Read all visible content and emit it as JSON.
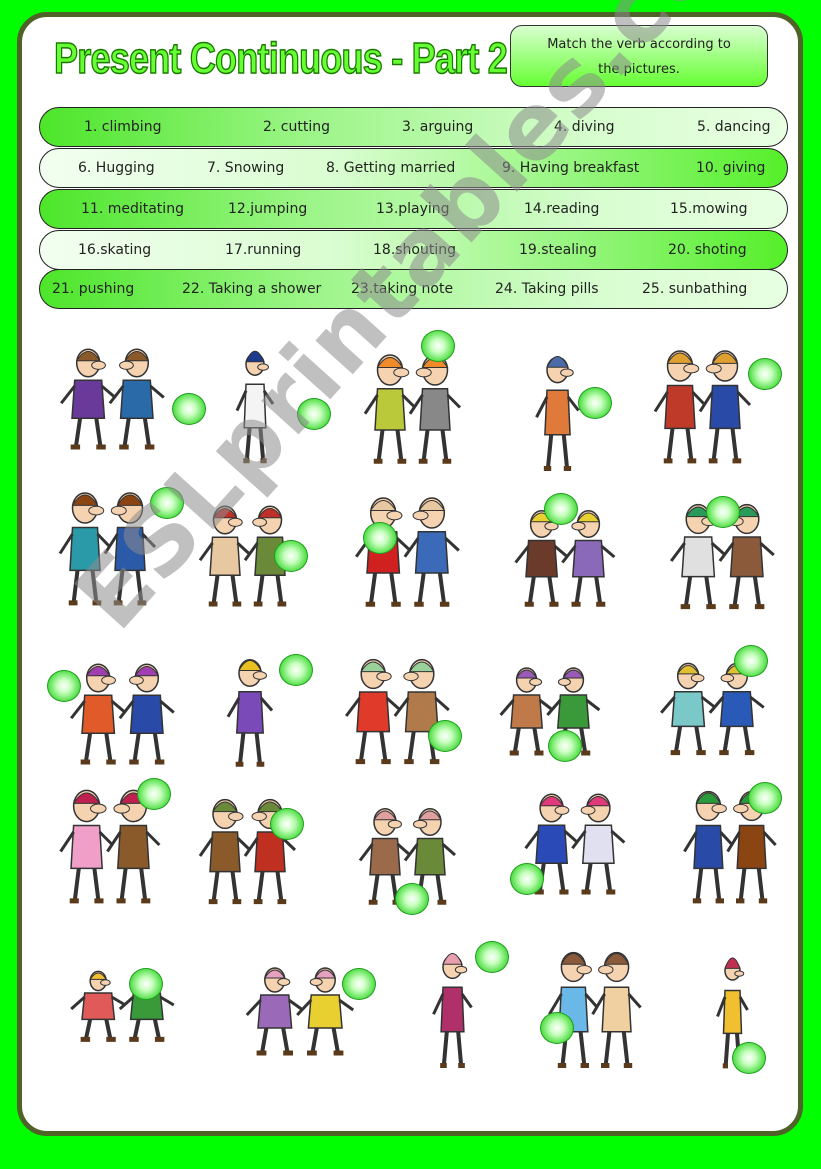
{
  "page": {
    "title": "Present Continuous - Part 2",
    "instructions": "Match the verb according to the pictures.",
    "instructions_line1": "Match the verb according to",
    "instructions_line2": "the pictures.",
    "watermark": "ESLprintables.com",
    "colors": {
      "background": "#00ff00",
      "frame": "#4f6228",
      "title_fill": "#66ff33",
      "row_green": "#4de52a",
      "row_pale": "#e8ffe2",
      "answer_dot": "#55e04a"
    }
  },
  "word_bank": [
    {
      "style": "a",
      "words": [
        "1.   climbing",
        "2. cutting",
        "3. arguing",
        "4. diving",
        "5. dancing"
      ]
    },
    {
      "style": "b",
      "words": [
        "6.  Hugging",
        "7. Snowing",
        "8. Getting married",
        "9. Having breakfast",
        "10. giving"
      ]
    },
    {
      "style": "a",
      "words": [
        "11. meditating",
        "12.jumping",
        "13.playing",
        "14.reading",
        "15.mowing"
      ]
    },
    {
      "style": "b",
      "words": [
        "16.skating",
        "17.running",
        "18.shouting",
        "19.stealing",
        "20. shoting"
      ]
    },
    {
      "style": "a",
      "words": [
        "21. pushing",
        "22. Taking a shower",
        "23.taking note",
        "24. Taking pills",
        "25. sunbathing"
      ]
    }
  ],
  "pictures": [
    {
      "scene": "snowing",
      "answer": ""
    },
    {
      "scene": "getting-married",
      "answer": ""
    },
    {
      "scene": "giving-flowers",
      "answer": ""
    },
    {
      "scene": "hugging",
      "answer": ""
    },
    {
      "scene": "having-breakfast",
      "answer": ""
    },
    {
      "scene": "jumping",
      "answer": ""
    },
    {
      "scene": "meditating",
      "answer": ""
    },
    {
      "scene": "mowing",
      "answer": ""
    },
    {
      "scene": "playing-music",
      "answer": ""
    },
    {
      "scene": "reading-newspaper",
      "answer": ""
    },
    {
      "scene": "arguing",
      "answer": ""
    },
    {
      "scene": "climbing",
      "answer": ""
    },
    {
      "scene": "cutting-hair",
      "answer": ""
    },
    {
      "scene": "dancing",
      "answer": ""
    },
    {
      "scene": "diving",
      "answer": ""
    },
    {
      "scene": "running",
      "answer": ""
    },
    {
      "scene": "shooting",
      "answer": ""
    },
    {
      "scene": "shouting",
      "answer": ""
    },
    {
      "scene": "skating",
      "answer": ""
    },
    {
      "scene": "stealing",
      "answer": ""
    },
    {
      "scene": "sunbathing",
      "answer": ""
    },
    {
      "scene": "pushing-strollers",
      "answer": ""
    },
    {
      "scene": "taking-pills",
      "answer": ""
    },
    {
      "scene": "taking-shower",
      "answer": ""
    },
    {
      "scene": "taking-note",
      "answer": ""
    }
  ]
}
